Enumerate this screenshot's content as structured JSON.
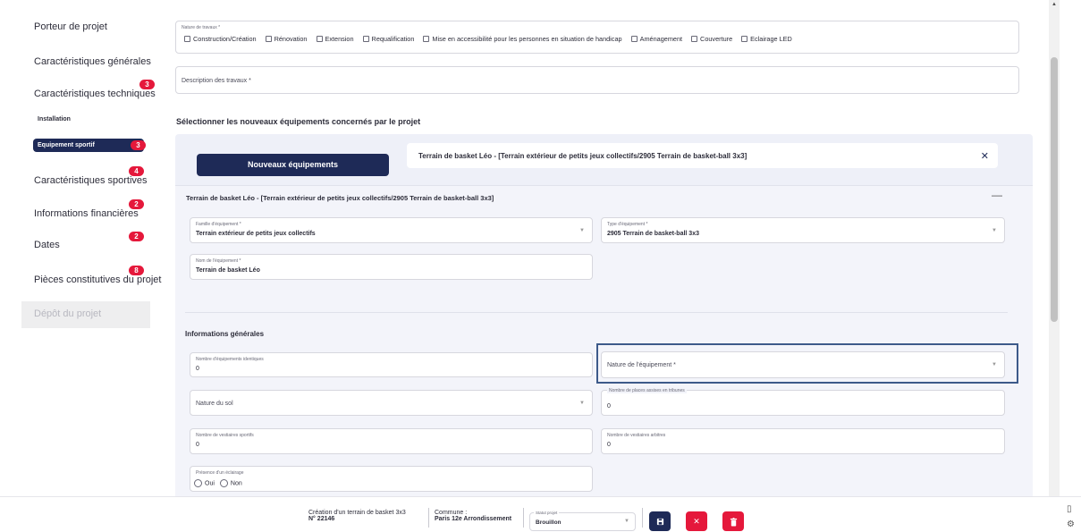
{
  "sidebar": {
    "items": [
      {
        "label": "Porteur de projet"
      },
      {
        "label": "Caractéristiques générales"
      },
      {
        "label": "Caractéristiques techniques",
        "badge": "3"
      },
      {
        "label": "Caractéristiques sportives",
        "badge": "4"
      },
      {
        "label": "Informations financières",
        "badge": "2"
      },
      {
        "label": "Dates",
        "badge": "2"
      },
      {
        "label": "Pièces constitutives du projet",
        "badge": "8"
      }
    ],
    "sub_installation": "Installation",
    "sub_equipement": "Equipement sportif",
    "sub_equipement_badge": "3",
    "disabled": "Dépôt du projet"
  },
  "form": {
    "nature_travaux_label": "Nature de travaux *",
    "checkboxes": [
      "Construction/Création",
      "Rénovation",
      "Extension",
      "Requalification",
      "Mise en accessibilité pour les personnes en situation de handicap",
      "Aménagement",
      "Couverture",
      "Eclairage LED"
    ],
    "description_placeholder": "Description des travaux *",
    "select_title": "Sélectionner les nouveaux équipements concernés par le projet",
    "new_equip_button": "Nouveaux équipements",
    "chip_text": "Terrain de basket Léo - [Terrain extérieur de petits jeux collectifs/2905 Terrain de basket-ball 3x3]",
    "chip_close": "✕",
    "equip_title": "Terrain de basket Léo - [Terrain extérieur de petits jeux collectifs/2905 Terrain de basket-ball 3x3]",
    "collapse": "—",
    "famille_label": "Famille d'équipement *",
    "famille_value": "Terrain extérieur de petits jeux collectifs",
    "type_label": "Type d'équipement *",
    "type_value": "2905 Terrain de basket-ball 3x3",
    "nom_label": "Nom de l'équipement *",
    "nom_value": "Terrain de basket Léo",
    "infos_title": "Informations générales",
    "nb_identiques_label": "Nombre d'équipements identiques",
    "nb_identiques_value": "0",
    "nature_equip_placeholder": "Nature de l'équipement *",
    "nature_sol_placeholder": "Nature du sol",
    "places_label": "Nombre de places assises en tribunes",
    "places_value": "0",
    "vest_sportifs_label": "Nombre de vestiaires sportifs",
    "vest_sportifs_value": "0",
    "vest_arbitres_label": "Nombre de vestiaires arbitres",
    "vest_arbitres_value": "0",
    "eclairage_label": "Présence d'un éclairage",
    "oui": "Oui",
    "non": "Non"
  },
  "footer": {
    "project_name": "Création d'un terrain de basket 3x3",
    "project_number": "N° 22146",
    "commune_label": "Commune :",
    "commune_value": "Paris 12e Arrondissement",
    "status_label": "Statut projet",
    "status_value": "Brouillon"
  },
  "colors": {
    "navy": "#1e2a57",
    "red": "#e5183b",
    "highlight": "#3d5a8a"
  }
}
